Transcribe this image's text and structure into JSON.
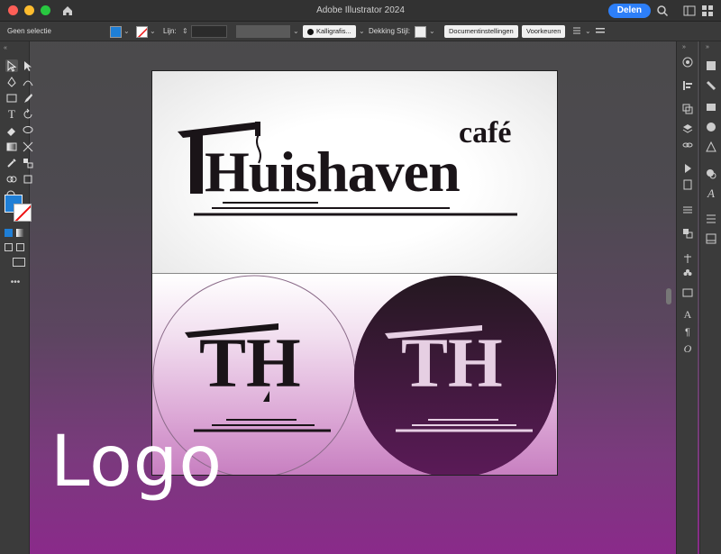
{
  "window": {
    "title": "Adobe Illustrator 2024",
    "share_label": "Delen"
  },
  "controlbar": {
    "selection_status": "Geen selectie",
    "stroke_label": "Lijn:",
    "brush_name": "Kalligrafis...",
    "opacity_label": "Dekking",
    "style_label": "Stijl:",
    "doc_settings_button": "Documentinstellingen",
    "preferences_button": "Voorkeuren",
    "fill_color": "#1f7fd6"
  },
  "artwork": {
    "wordmark_main": "THuishaven",
    "wordmark_cafe": "café",
    "monogram": "TH",
    "dark_circle_color": "#4a1a48"
  },
  "overlay": {
    "label": "Logo"
  },
  "colors": {
    "accent": "#2d7ff9",
    "background_bottom": "#8a2a8a"
  }
}
